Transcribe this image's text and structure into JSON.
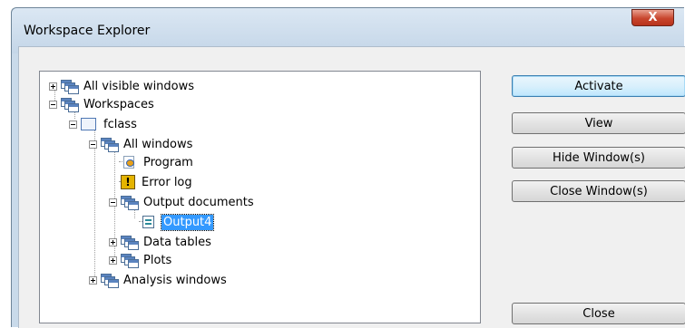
{
  "window": {
    "title": "Workspace Explorer",
    "close_glyph": "X"
  },
  "tree": {
    "items": [
      {
        "label": "All visible windows",
        "icon": "windows-stack-icon"
      },
      {
        "label": "Workspaces",
        "icon": "windows-stack-icon"
      },
      {
        "label": "fclass",
        "icon": "workspace-box-icon"
      },
      {
        "label": "All windows",
        "icon": "windows-stack-icon"
      },
      {
        "label": "Program",
        "icon": "program-icon"
      },
      {
        "label": "Error log",
        "icon": "error-log-icon"
      },
      {
        "label": "Output documents",
        "icon": "windows-stack-icon"
      },
      {
        "label": "Output4",
        "icon": "output-document-icon",
        "selected": true
      },
      {
        "label": "Data tables",
        "icon": "windows-stack-icon"
      },
      {
        "label": "Plots",
        "icon": "windows-stack-icon"
      },
      {
        "label": "Analysis windows",
        "icon": "windows-stack-icon"
      }
    ],
    "error_glyph": "!"
  },
  "buttons": {
    "activate": "Activate",
    "view": "View",
    "hide": "Hide Window(s)",
    "close_windows": "Close Window(s)",
    "close": "Close"
  }
}
